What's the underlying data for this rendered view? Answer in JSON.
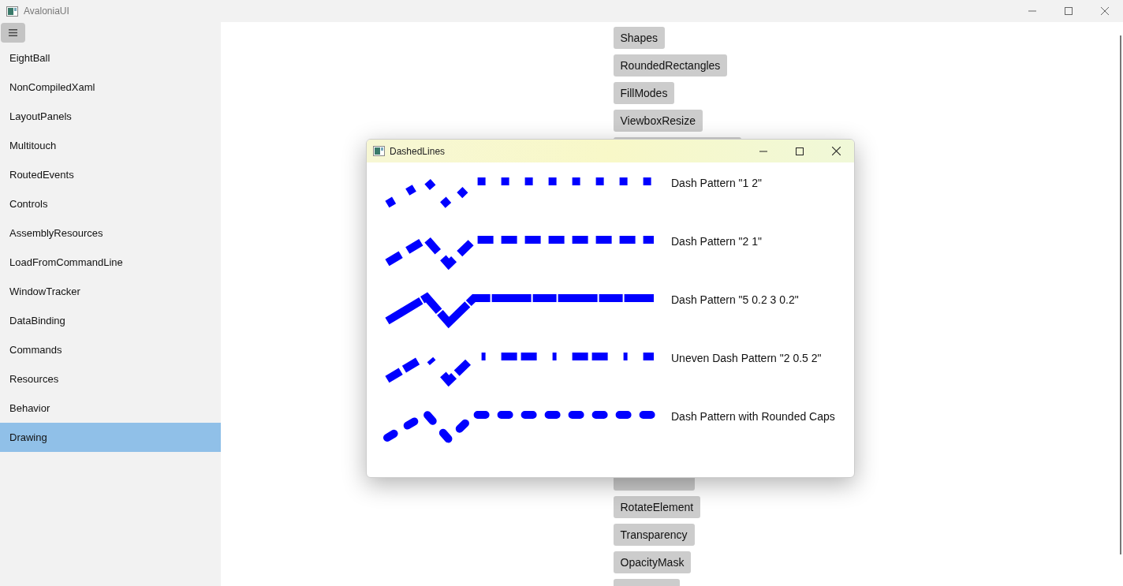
{
  "window": {
    "title": "AvaloniaUI"
  },
  "sidebar": {
    "items": [
      {
        "label": "EightBall",
        "selected": false
      },
      {
        "label": "NonCompiledXaml",
        "selected": false
      },
      {
        "label": "LayoutPanels",
        "selected": false
      },
      {
        "label": "Multitouch",
        "selected": false
      },
      {
        "label": "RoutedEvents",
        "selected": false
      },
      {
        "label": "Controls",
        "selected": false
      },
      {
        "label": "AssemblyResources",
        "selected": false
      },
      {
        "label": "LoadFromCommandLine",
        "selected": false
      },
      {
        "label": "WindowTracker",
        "selected": false
      },
      {
        "label": "DataBinding",
        "selected": false
      },
      {
        "label": "Commands",
        "selected": false
      },
      {
        "label": "Resources",
        "selected": false
      },
      {
        "label": "Behavior",
        "selected": false
      },
      {
        "label": "Drawing",
        "selected": true
      }
    ]
  },
  "buttons_top": [
    "Shapes",
    "RoundedRectangles",
    "FillModes",
    "ViewboxResize"
  ],
  "buttons_bottom": [
    "RotateElement",
    "Transparency",
    "OpacityMask"
  ],
  "dialog": {
    "title": "DashedLines",
    "rows": [
      {
        "label": "Dash Pattern \"1 2\"",
        "kind": "square"
      },
      {
        "label": "Dash Pattern \"2 1\"",
        "kind": "square"
      },
      {
        "label": "Dash Pattern \"5 0.2 3 0.2\"",
        "kind": "square"
      },
      {
        "label": "Uneven Dash Pattern \"2 0.5 2\"",
        "kind": "square"
      },
      {
        "label": "Dash Pattern with Rounded Caps",
        "kind": "round"
      }
    ]
  }
}
